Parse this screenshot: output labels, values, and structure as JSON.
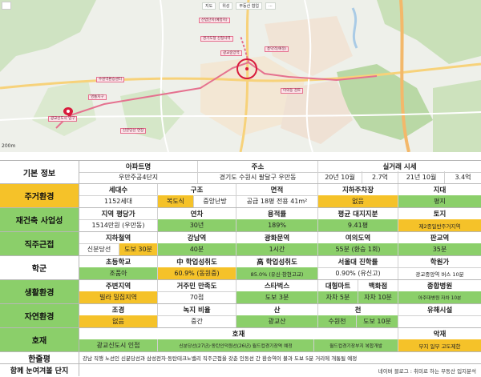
{
  "map": {
    "toolbar": [
      "지도",
      "위성",
      "부동산 협업",
      "⋯"
    ],
    "scale": "200m",
    "labels": [
      "산업단지(예정지)",
      "경기도청 신청사역",
      "광교중앙역",
      "수원역환승센터",
      "영통지구",
      "광교신도시 입구",
      "신분당선 연장",
      "흥덕역(예정)",
      "이의동 검토"
    ],
    "colors": {
      "route": "#e5718f",
      "target_circle": "#d81b3c",
      "pin": "#d81b3c"
    }
  },
  "table": {
    "basic": {
      "header": "기본 정보",
      "apt_title": "아파트명",
      "apt_value": "우만주공4단지",
      "addr_title": "주소",
      "addr_value": "경기도 수원시 팔달구 우만동",
      "price_title": "실거래 시세",
      "p1_date": "20년 10월",
      "p1_price": "2.7억",
      "p2_date": "21년 10월",
      "p2_price": "3.4억"
    },
    "living": {
      "header": "주거환경",
      "titles": [
        "세대수",
        "구조",
        "면적",
        "지하주차장",
        "지대"
      ],
      "households": "1152세대",
      "structure": "복도식",
      "heating": "중앙난방",
      "area": "공급 18평  전용 41m²",
      "parking": "없음",
      "terrain": "평지"
    },
    "rebuild": {
      "header": "재건축 사업성",
      "titles": [
        "지역 평당가",
        "연차",
        "용적률",
        "평균 대지지분",
        "토지"
      ],
      "values": [
        "1514만원 (우만동)",
        "30년",
        "189%",
        "9.41평",
        "제2종일반주거지역"
      ]
    },
    "commute": {
      "header": "직주근접",
      "titles": [
        "지하철역",
        "강남역",
        "광화문역",
        "여의도역",
        "판교역"
      ],
      "station_line": "신분당선",
      "station_walk": "도보 30분",
      "values": [
        "40분",
        "1시간",
        "55분 (환승 1회)",
        "35분"
      ]
    },
    "school": {
      "header": "학군",
      "titles": [
        "초등학교",
        "中 학업성취도",
        "高 학업성취도",
        "서울대 진학률",
        "학원가"
      ],
      "values": [
        "조품아",
        "60.9% (동원중)",
        "85.0% (유신·창현고교)",
        "0.90% (유신고)",
        "광교중앙역  버스 10분"
      ]
    },
    "life": {
      "header": "생활환경",
      "titles": [
        "주변지역",
        "거주민 만족도",
        "스타벅스",
        "대형마트",
        "백화점",
        "종합병원"
      ],
      "values": [
        "빌라 밀집지역",
        "70점",
        "도보 3분",
        "자차 5분",
        "자차 10분",
        "아주대병원 자차 10분"
      ]
    },
    "nature": {
      "header": "자연환경",
      "titles": [
        "조경",
        "녹지 비율",
        "산",
        "천",
        "유해시설"
      ],
      "landscape": "없음",
      "green": "중간",
      "mountain": "광교산",
      "stream_name": "수원천",
      "stream_walk": "도보 10분",
      "hazard": ""
    },
    "factor": {
      "header": "호재",
      "good_title": "호재",
      "bad_title": "악재",
      "good": [
        "광교신도시 인접",
        "신분당선(27년)·동탄인덕원선(26년) 월드컵경기장역 예정",
        "월드컵경기장부지 복합개발"
      ],
      "bad": "부지 일부 고도제한"
    },
    "summary": {
      "header": "한줄평",
      "text": "강남 직행 노선인 신분당선과 삼성전자·동탄테크노밸리 직주근접을 갖춘 인동선 간 환승역이 불과 도보 5분 거리에 개통될 예정"
    },
    "watch": {
      "header": "함께 눈여겨볼 단지",
      "text": ""
    },
    "footer": "네이버 블로그 : 취미로 하는 부동산 입지분석"
  }
}
